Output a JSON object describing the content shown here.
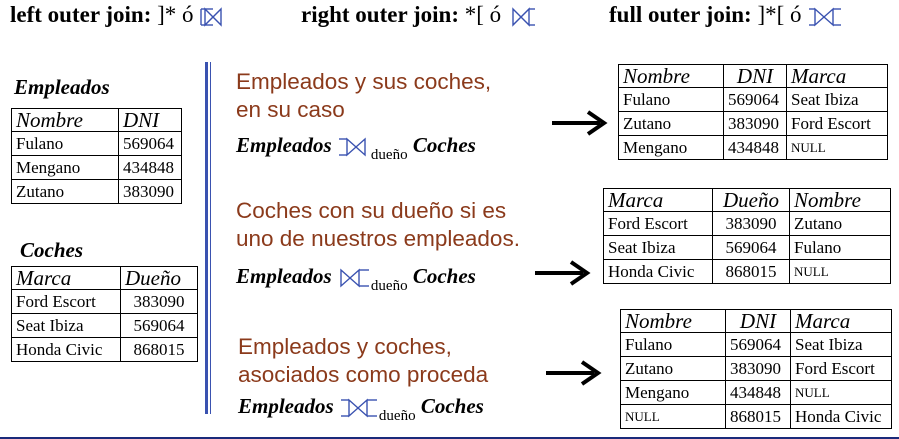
{
  "header": {
    "left": {
      "label": "left outer join",
      "sep": ":",
      "symbol": "]* ó"
    },
    "right": {
      "label": "right outer join",
      "sep": ":",
      "symbol": "*[ ó"
    },
    "full": {
      "label": "full outer join",
      "sep": ":",
      "symbol": "]*[ ó"
    }
  },
  "empleados": {
    "title": "Empleados",
    "headers": [
      "Nombre",
      "DNI"
    ],
    "rows": [
      [
        "Fulano",
        "569064"
      ],
      [
        "Mengano",
        "434848"
      ],
      [
        "Zutano",
        "383090"
      ]
    ]
  },
  "coches": {
    "title": "Coches",
    "headers": [
      "Marca",
      "Dueño"
    ],
    "rows": [
      [
        "Ford Escort",
        "383090"
      ],
      [
        "Seat Ibiza",
        "569064"
      ],
      [
        "Honda Civic",
        "868015"
      ]
    ]
  },
  "sections": [
    {
      "desc1": "Empleados y sus coches,",
      "desc2": "en su caso",
      "left": "Empleados",
      "sub": "dueño",
      "right": "Coches",
      "headers": [
        "Nombre",
        "DNI",
        "Marca"
      ],
      "rows": [
        [
          "Fulano",
          "569064",
          "Seat Ibiza"
        ],
        [
          "Zutano",
          "383090",
          "Ford Escort"
        ],
        [
          "Mengano",
          "434848",
          "NULL"
        ]
      ]
    },
    {
      "desc1": "Coches con su dueño si es",
      "desc2": "uno de nuestros empleados.",
      "left": "Empleados",
      "sub": "dueño",
      "right": "Coches",
      "headers": [
        "Marca",
        "Dueño",
        "Nombre"
      ],
      "rows": [
        [
          "Ford Escort",
          "383090",
          "Zutano"
        ],
        [
          "Seat Ibiza",
          "569064",
          "Fulano"
        ],
        [
          "Honda Civic",
          "868015",
          "NULL"
        ]
      ]
    },
    {
      "desc1": "Empleados y coches,",
      "desc2": "asociados como proceda",
      "left": "Empleados",
      "sub": "dueño",
      "right": "Coches",
      "headers": [
        "Nombre",
        "DNI",
        "Marca"
      ],
      "rows": [
        [
          "Fulano",
          "569064",
          "Seat Ibiza"
        ],
        [
          "Zutano",
          "383090",
          "Ford Escort"
        ],
        [
          "Mengano",
          "434848",
          "NULL"
        ],
        [
          "NULL",
          "868015",
          "Honda Civic"
        ]
      ]
    }
  ]
}
